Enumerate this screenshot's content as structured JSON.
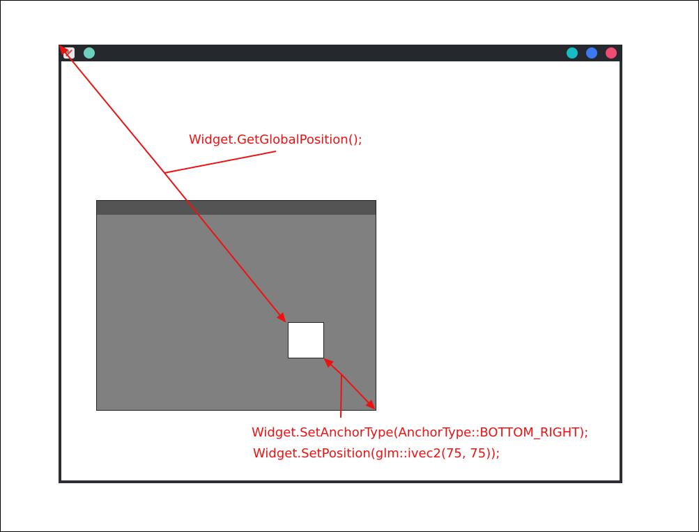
{
  "annotations": {
    "get_global_position": "Widget.GetGlobalPosition();",
    "set_anchor_type": "Widget.SetAnchorType(AnchorType::BOTTOM_RIGHT);",
    "set_position": "Widget.SetPosition(glm::ivec2(75, 75));"
  },
  "window": {
    "titlebar_buttons": [
      "menu-dot",
      "minimize-dot",
      "maximize-dot",
      "close-dot"
    ]
  },
  "colors": {
    "annotation": "#ee1111",
    "titlebar": "#25282d",
    "panel": "#808080",
    "panel_header": "#545454",
    "dot_menu": "#6fcfbe",
    "dot_min": "#16bcc7",
    "dot_max": "#3c78f0",
    "dot_close": "#ef4c73"
  }
}
